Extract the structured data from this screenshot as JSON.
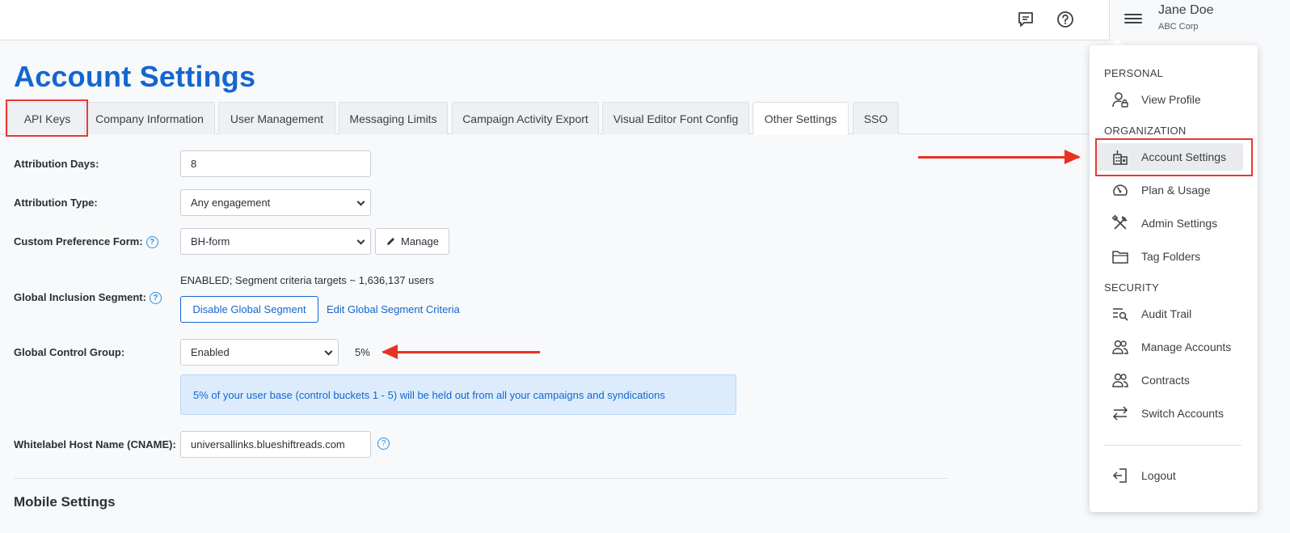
{
  "header": {
    "user_name": "Jane Doe",
    "user_org": "ABC Corp"
  },
  "page_title": "Account Settings",
  "tabs": [
    {
      "label": "API Keys"
    },
    {
      "label": "Company Information"
    },
    {
      "label": "User Management"
    },
    {
      "label": "Messaging Limits"
    },
    {
      "label": "Campaign Activity Export"
    },
    {
      "label": "Visual Editor Font Config"
    },
    {
      "label": "Other Settings"
    },
    {
      "label": "SSO"
    }
  ],
  "form": {
    "attribution_days": {
      "label": "Attribution Days:",
      "value": "8"
    },
    "attribution_type": {
      "label": "Attribution Type:",
      "value": "Any engagement"
    },
    "custom_preference_form": {
      "label": "Custom Preference Form:",
      "value": "BH-form",
      "manage_label": "Manage"
    },
    "global_inclusion_segment": {
      "label": "Global Inclusion Segment:",
      "status": "ENABLED; Segment criteria targets ~ 1,636,137 users",
      "disable_label": "Disable Global Segment",
      "edit_label": "Edit Global Segment Criteria"
    },
    "global_control_group": {
      "label": "Global Control Group:",
      "value": "Enabled",
      "percent": "5%",
      "info": "5% of your user base (control buckets 1 - 5) will be held out from all your campaigns and syndications"
    },
    "whitelabel_host": {
      "label": "Whitelabel Host Name (CNAME):",
      "value": "universallinks.blueshiftreads.com"
    }
  },
  "mobile_settings_title": "Mobile Settings",
  "menu": {
    "sections": {
      "personal": "PERSONAL",
      "organization": "ORGANIZATION",
      "security": "SECURITY"
    },
    "items": {
      "view_profile": "View Profile",
      "account_settings": "Account Settings",
      "plan_usage": "Plan & Usage",
      "admin_settings": "Admin Settings",
      "tag_folders": "Tag Folders",
      "audit_trail": "Audit Trail",
      "manage_accounts": "Manage Accounts",
      "contracts": "Contracts",
      "switch_accounts": "Switch Accounts",
      "logout": "Logout"
    }
  },
  "colors": {
    "brand_blue": "#1466d0",
    "annotation_red": "#e8321f",
    "info_bg": "#dcecfd"
  }
}
